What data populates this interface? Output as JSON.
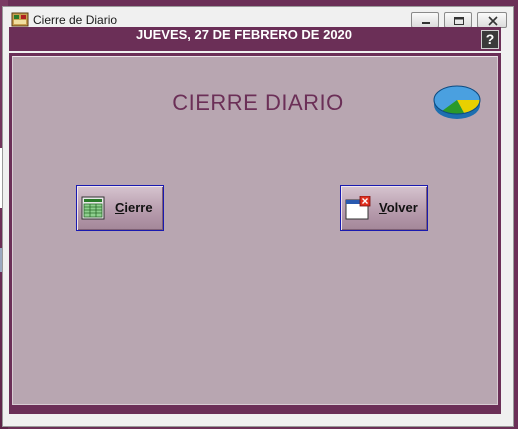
{
  "window": {
    "title": "Cierre de Diario",
    "controls": {
      "minimize": "minimize",
      "maximize": "maximize",
      "close": "close"
    }
  },
  "header": {
    "date": "JUEVES, 27 DE FEBRERO DE 2020",
    "help_label": "?"
  },
  "main": {
    "heading": "CIERRE DIARIO",
    "buttons": {
      "cierre": {
        "label": "Cierre",
        "icon": "spreadsheet-icon"
      },
      "volver": {
        "label": "Volver",
        "icon": "window-close-icon"
      }
    }
  },
  "colors": {
    "frame": "#6b2f57",
    "panel": "#b8a6b1",
    "button_border": "#1a1ab0"
  }
}
